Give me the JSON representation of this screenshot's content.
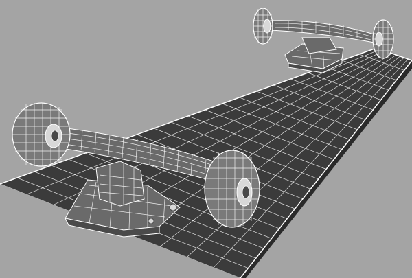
{
  "scene": {
    "subject": "skateboard-wireframe-render",
    "background_color": "#a4a4a4",
    "deck_fill": "#3b3b3b",
    "deck_edge": "#2a2a2a",
    "wire_color": "#ffffff",
    "metal_fill": "#6a6a6a",
    "metal_dark": "#4a4a4a",
    "wheel_fill": "#7a7a7a",
    "hub_fill": "#d8d8d8"
  }
}
